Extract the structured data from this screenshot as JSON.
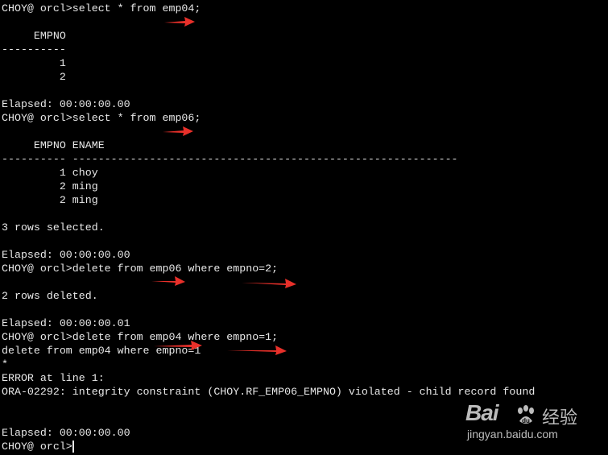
{
  "terminal": {
    "lines": [
      "CHOY@ orcl>select * from emp04;",
      "",
      "     EMPNO",
      "----------",
      "         1",
      "         2",
      "",
      "Elapsed: 00:00:00.00",
      "CHOY@ orcl>select * from emp06;",
      "",
      "     EMPNO ENAME",
      "---------- ------------------------------------------------------------",
      "         1 choy",
      "         2 ming",
      "         2 ming",
      "",
      "3 rows selected.",
      "",
      "Elapsed: 00:00:00.00",
      "CHOY@ orcl>delete from emp06 where empno=2;",
      "",
      "2 rows deleted.",
      "",
      "Elapsed: 00:00:00.01",
      "CHOY@ orcl>delete from emp04 where empno=1;",
      "delete from emp04 where empno=1",
      "*",
      "ERROR at line 1:",
      "ORA-02292: integrity constraint (CHOY.RF_EMP06_EMPNO) violated - child record found",
      "",
      "",
      "Elapsed: 00:00:00.00",
      "CHOY@ orcl>"
    ]
  },
  "watermark": {
    "logo": "Bai",
    "cn": "经验",
    "url": "jingyan.baidu.com"
  },
  "colors": {
    "background": "#000000",
    "text": "#e8e8e8",
    "arrow": "#e8302a"
  }
}
